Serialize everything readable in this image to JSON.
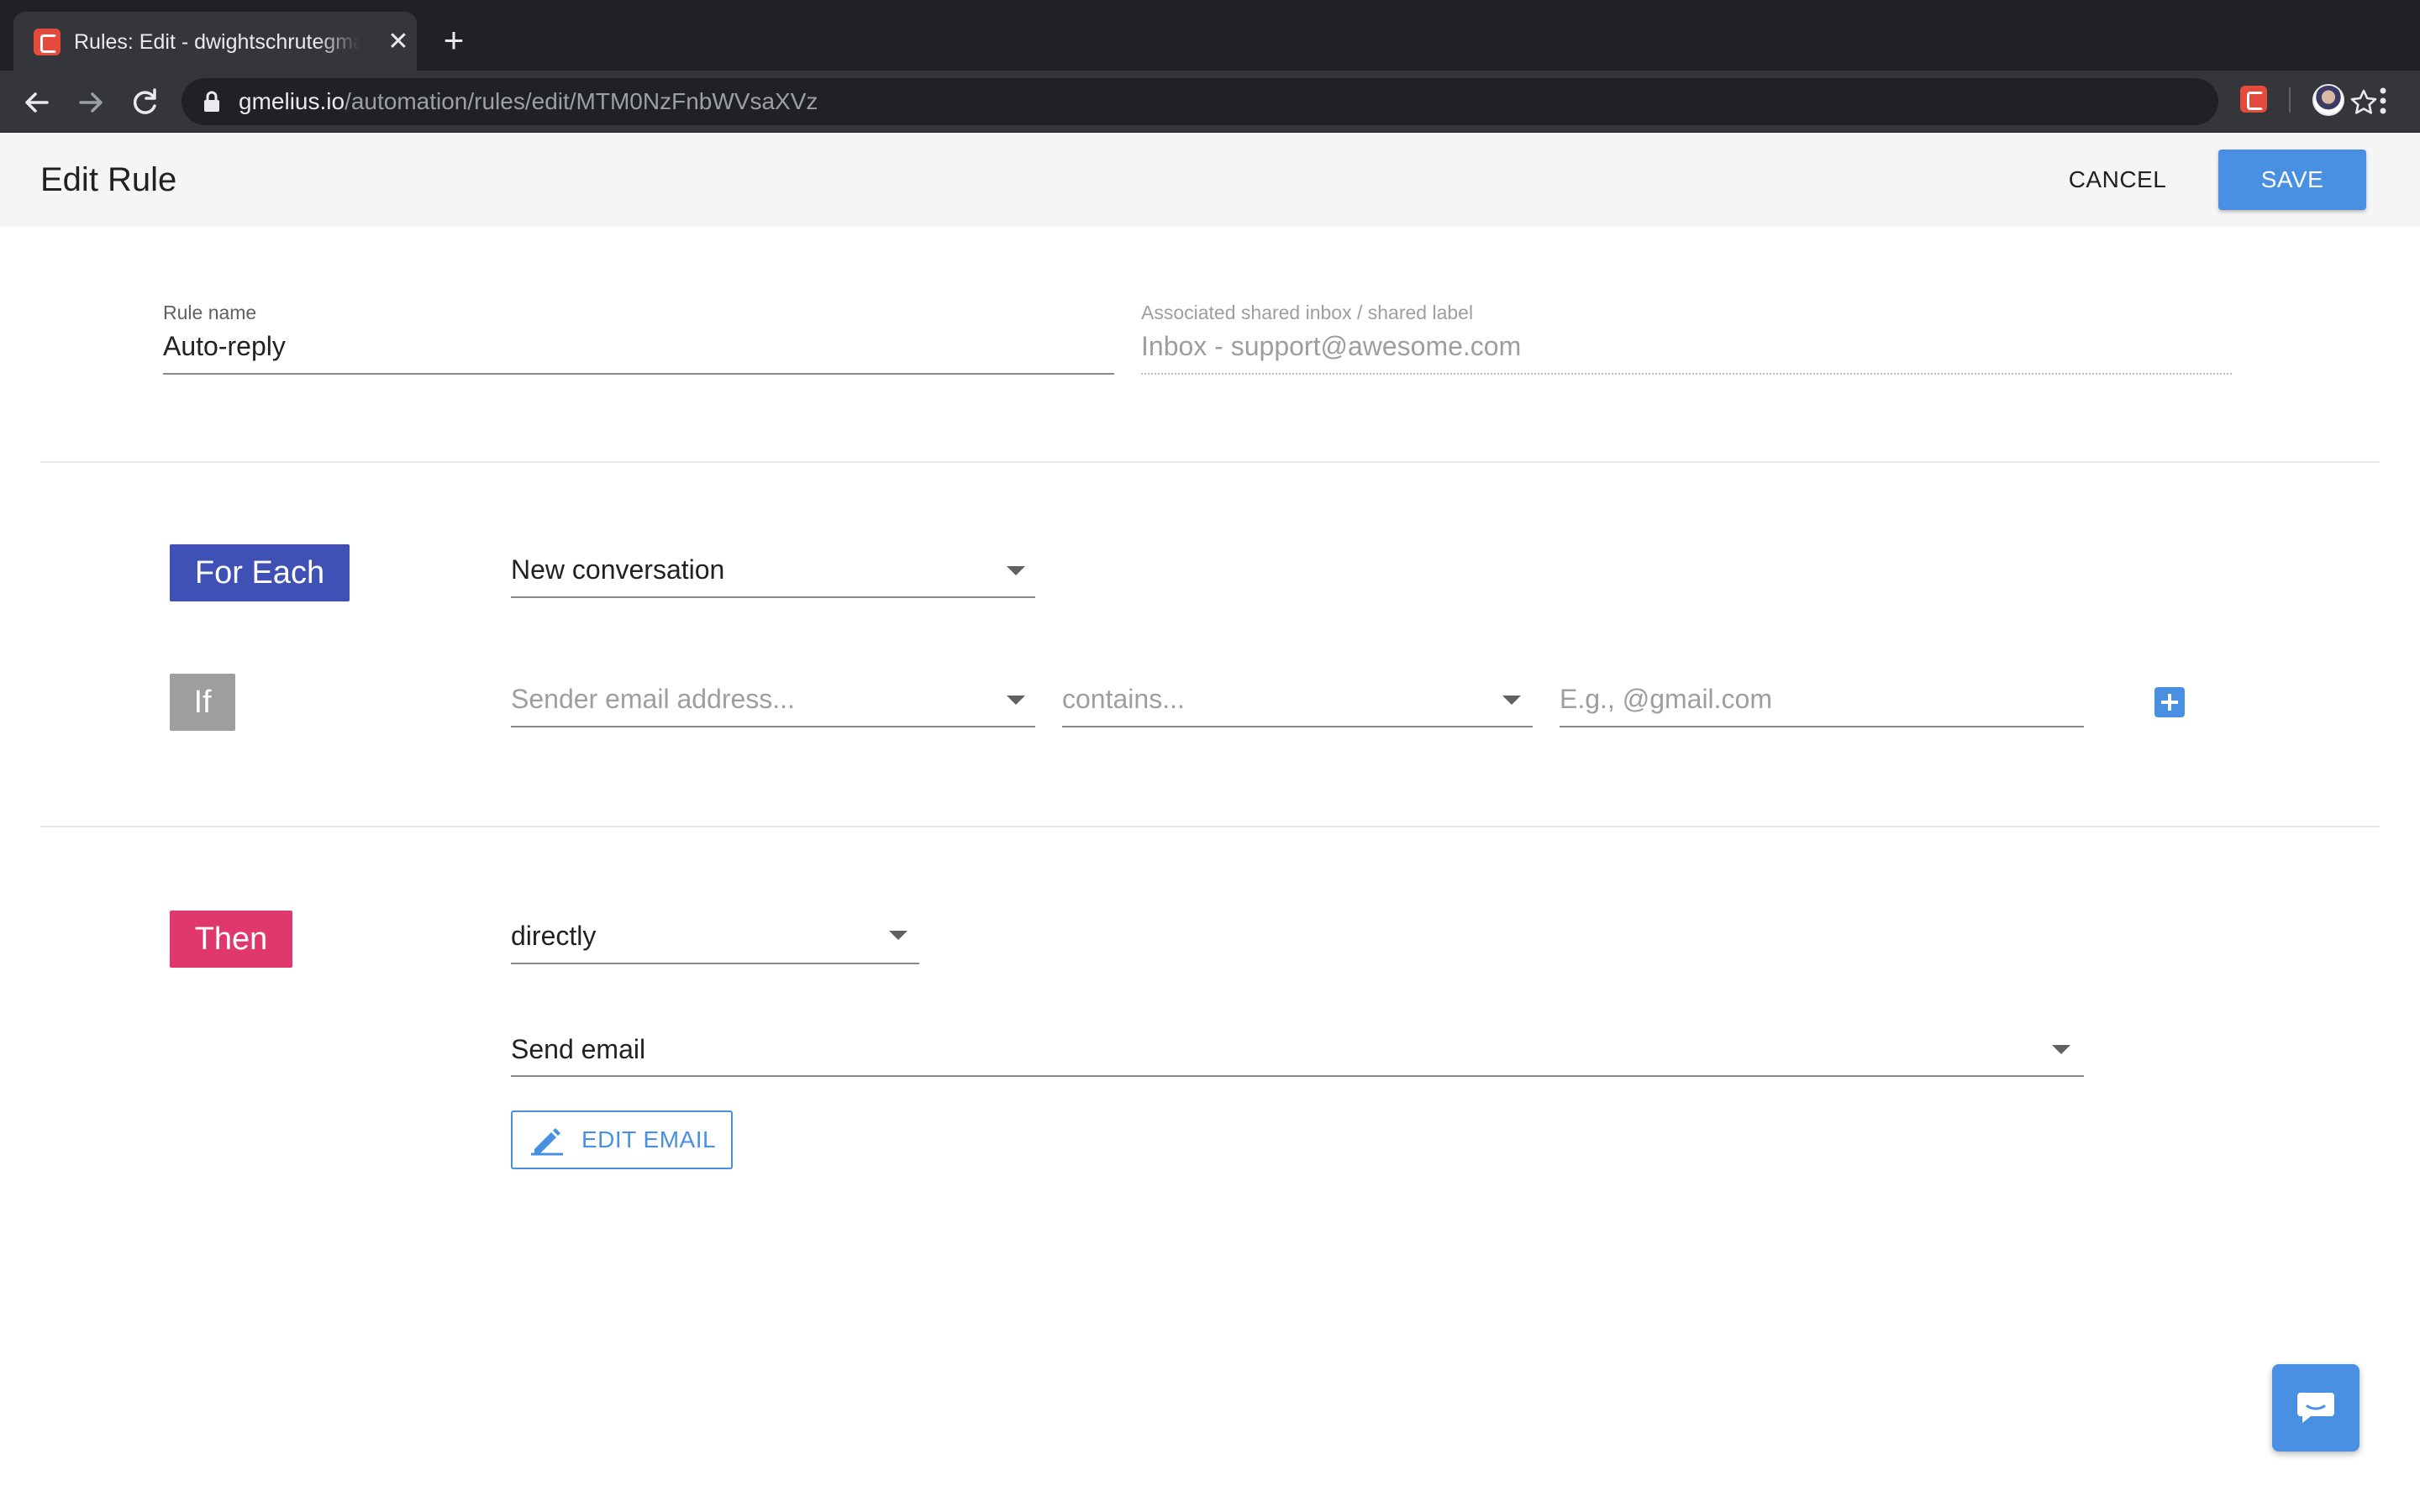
{
  "browser": {
    "tab": {
      "title": "Rules: Edit - dwightschrutegmail",
      "favicon": "gmelius-icon",
      "close_icon": "close-icon"
    },
    "new_tab_icon": "plus-icon",
    "url": {
      "host": "gmelius.io",
      "path": "/automation/rules/edit/MTM0NzFnbWVsaXVz"
    }
  },
  "header": {
    "title": "Edit Rule",
    "cancel_label": "CANCEL",
    "save_label": "SAVE"
  },
  "rule": {
    "name_label": "Rule name",
    "name_value": "Auto-reply",
    "inbox_label": "Associated shared inbox / shared label",
    "inbox_value": "Inbox - support@awesome.com"
  },
  "trigger": {
    "for_each_chip": "For Each",
    "for_each_value": "New conversation",
    "if_chip": "If",
    "condition_field_placeholder": "Sender email address...",
    "condition_operator_placeholder": "contains...",
    "condition_value_placeholder": "E.g., @gmail.com"
  },
  "action": {
    "then_chip": "Then",
    "timing_value": "directly",
    "action_value": "Send email",
    "edit_email_label": "EDIT EMAIL"
  },
  "colors": {
    "accent": "#4a90e2",
    "for_each": "#3f51b5",
    "if": "#9e9e9e",
    "then": "#e0386c"
  }
}
